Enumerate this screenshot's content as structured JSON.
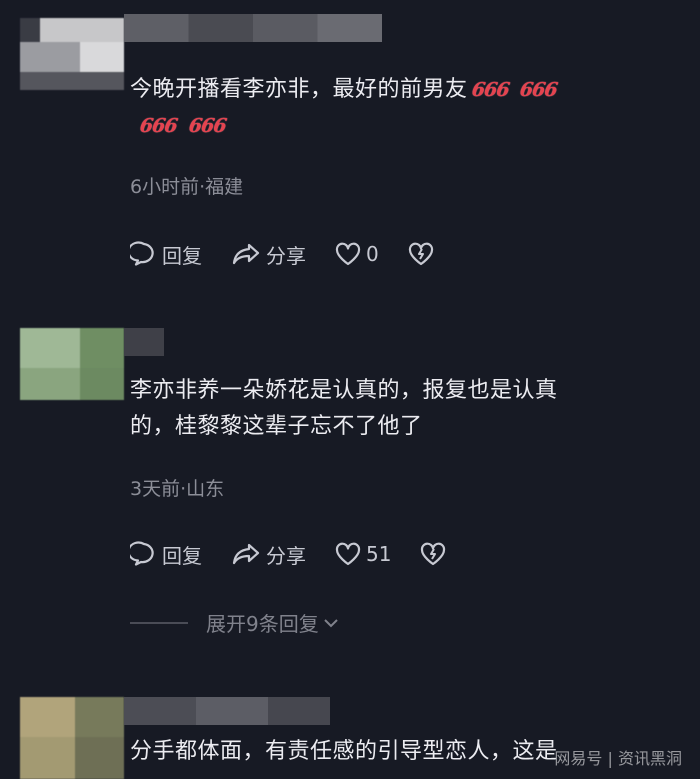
{
  "comments": [
    {
      "text_before": "今晚开播看李亦非，最好的前男友",
      "emojis": [
        "666",
        "666",
        "666",
        "666"
      ],
      "meta": "6小时前·福建",
      "reply_label": "回复",
      "share_label": "分享",
      "like_count": "0"
    },
    {
      "text_line1": "李亦非养一朵娇花是认真的，报复也是认真",
      "text_line2": "的，桂黎黎这辈子忘不了他了",
      "meta": "3天前·山东",
      "reply_label": "回复",
      "share_label": "分享",
      "like_count": "51",
      "expand_label": "展开9条回复"
    },
    {
      "text": "分手都体面，有责任感的引导型恋人，这是"
    }
  ],
  "watermark": "网易号 | 资讯黑洞",
  "colors": {
    "background": "#171a24",
    "text": "#ececf1",
    "meta": "#8c8e98",
    "emoji": "#e5434f"
  },
  "icons": [
    "comment-bubble-icon",
    "share-arrow-icon",
    "heart-icon",
    "broken-heart-icon",
    "chevron-down-icon"
  ]
}
